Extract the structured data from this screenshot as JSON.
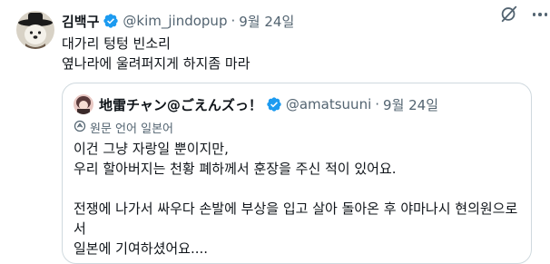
{
  "tweet": {
    "author_name": "김백구",
    "handle": "@kim_jindopup",
    "separator": "·",
    "date": "9월 24일",
    "lines": [
      "대가리 텅텅 빈소리",
      "옆나라에 울려퍼지게 하지좀 마라"
    ]
  },
  "quoted": {
    "author_name": "地雷チャン@ごえんズっ！",
    "handle": "@amatsuuni",
    "separator": "·",
    "date": "9월 24일",
    "translation_label": "원문 언어 일본어",
    "text": "이건 그냥 자랑일 뿐이지만,\n우리 할아버지는 천황 폐하께서 훈장을 주신 적이 있어요.\n\n전쟁에 나가서 싸우다 손발에 부상을 입고 살아 돌아온 후 야마나시 현의원으로서\n일본에 기여하셨어요...."
  },
  "colors": {
    "verified_blue": "#1d9bf0",
    "secondary_text": "#536471",
    "border": "#cfd9de"
  }
}
